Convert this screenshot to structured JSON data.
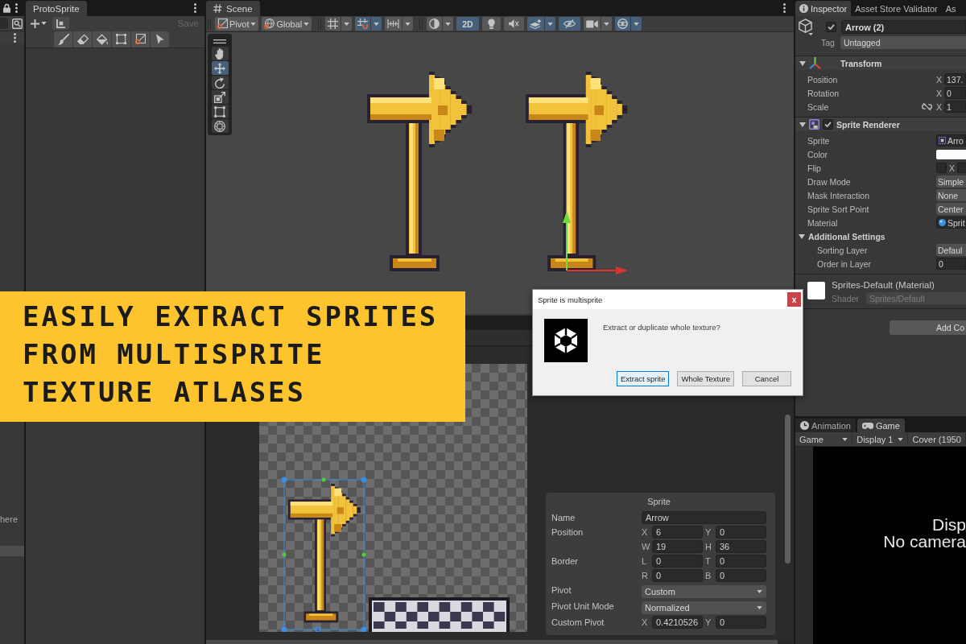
{
  "hierarchy": {
    "hint": "here",
    "rows": [
      {
        "selected": true
      }
    ]
  },
  "protosprite": {
    "tab": "ProtoSprite",
    "save": {
      "label": "Save",
      "disabled": true
    },
    "tools": [
      {
        "kind": "brush"
      },
      {
        "kind": "eraser"
      },
      {
        "kind": "fill"
      },
      {
        "kind": "select"
      },
      {
        "kind": "resize"
      },
      {
        "kind": "pointer"
      }
    ]
  },
  "scene": {
    "tab": "Scene",
    "toolbar": [
      {
        "items": [
          {
            "kind": "pivot",
            "label": "Pivot",
            "caret": true
          },
          {
            "kind": "global",
            "label": "Global",
            "caret": true
          }
        ]
      },
      {
        "items": [
          {
            "kind": "grid",
            "on": false,
            "caret": true
          },
          {
            "kind": "snap",
            "on": true,
            "caret": true
          },
          {
            "kind": "increment",
            "on": false,
            "caret": true
          }
        ]
      },
      {
        "items": [
          {
            "kind": "shading",
            "on": false,
            "caret": true
          },
          {
            "kind": "mode",
            "label": "2D",
            "on": true
          },
          {
            "kind": "light",
            "on": false
          },
          {
            "kind": "audio",
            "on": false
          },
          {
            "kind": "effects",
            "on": true,
            "caret": true
          },
          {
            "kind": "visibility",
            "on": true
          },
          {
            "kind": "camera",
            "on": false,
            "caret": true
          },
          {
            "kind": "gizmos",
            "on": true,
            "caret": true
          }
        ]
      }
    ],
    "tools": [
      {
        "kind": "hand",
        "selected": false
      },
      {
        "kind": "move",
        "selected": true
      },
      {
        "kind": "rotate",
        "selected": false
      },
      {
        "kind": "scale",
        "selected": false
      },
      {
        "kind": "rect",
        "selected": false
      },
      {
        "kind": "transform",
        "selected": false
      }
    ]
  },
  "sprite_editor": {
    "panel": {
      "title": "Sprite",
      "rows": [
        {
          "kind": "text",
          "label": "Name",
          "value": "Arrow"
        },
        {
          "kind": "pair",
          "label": "Position",
          "fields": [
            {
              "axis": "X",
              "value": "6"
            },
            {
              "axis": "Y",
              "value": "0"
            }
          ]
        },
        {
          "kind": "pair",
          "fields": [
            {
              "axis": "W",
              "value": "19"
            },
            {
              "axis": "H",
              "value": "36"
            }
          ]
        },
        {
          "kind": "pair",
          "label": "Border",
          "fields": [
            {
              "axis": "L",
              "value": "0"
            },
            {
              "axis": "T",
              "value": "0"
            }
          ]
        },
        {
          "kind": "pair",
          "fields": [
            {
              "axis": "R",
              "value": "0"
            },
            {
              "axis": "B",
              "value": "0"
            }
          ]
        },
        {
          "kind": "dropdown",
          "label": "Pivot",
          "value": "Custom"
        },
        {
          "kind": "dropdown",
          "label": "Pivot Unit Mode",
          "value": "Normalized"
        },
        {
          "kind": "pair",
          "label": "Custom Pivot",
          "fields": [
            {
              "axis": "X",
              "value": "0.4210526"
            },
            {
              "axis": "Y",
              "value": "0"
            }
          ]
        }
      ]
    }
  },
  "inspector": {
    "tabs": [
      {
        "kind": "info",
        "label": "Inspector",
        "selected": true
      },
      {
        "label": "Asset Store Validator",
        "selected": false
      },
      {
        "label": "As",
        "selected": false
      }
    ],
    "object": {
      "active": true,
      "name": "Arrow (2)",
      "tag_label": "Tag",
      "tag": "Untagged"
    },
    "components": [
      {
        "kind": "transform",
        "title": "Transform",
        "expanded": true,
        "rows": [
          {
            "kind": "vector",
            "label": "Position",
            "axis": "X",
            "value": "137."
          },
          {
            "kind": "vector",
            "label": "Rotation",
            "axis": "X",
            "value": "0"
          },
          {
            "kind": "vector",
            "label": "Scale",
            "axis": "X",
            "value": "1",
            "proportional": false
          }
        ]
      },
      {
        "kind": "sprite_renderer",
        "title": "Sprite Renderer",
        "enabled": true,
        "expanded": true,
        "rows": [
          {
            "kind": "sprite",
            "label": "Sprite",
            "value": "Arro"
          },
          {
            "kind": "color",
            "label": "Color",
            "color": "#ffffff"
          },
          {
            "kind": "flip",
            "label": "Flip",
            "axis": "X",
            "x": false,
            "y": false
          },
          {
            "kind": "dropdown",
            "label": "Draw Mode",
            "value": "Simple"
          },
          {
            "kind": "dropdown",
            "label": "Mask Interaction",
            "value": "None"
          },
          {
            "kind": "dropdown",
            "label": "Sprite Sort Point",
            "value": "Center"
          },
          {
            "kind": "material",
            "label": "Material",
            "value": "Sprit"
          }
        ],
        "subsection": {
          "title": "Additional Settings",
          "expanded": true,
          "rows": [
            {
              "kind": "dropdown",
              "label": "Sorting Layer",
              "value": "Defaul"
            },
            {
              "kind": "number",
              "label": "Order in Layer",
              "value": "0"
            }
          ]
        }
      }
    ],
    "material": {
      "name": "Sprites-Default (Material)",
      "shader_label": "Shader",
      "shader": "Sprites/Default"
    },
    "add_button": "Add Co"
  },
  "game": {
    "tabs": [
      {
        "kind": "animation",
        "label": "Animation",
        "selected": false
      },
      {
        "kind": "game",
        "label": "Game",
        "selected": true
      }
    ],
    "toolbar": [
      {
        "label": "Game",
        "caret": true
      },
      {
        "label": "Display 1",
        "caret": true
      },
      {
        "label": "Cover (1950",
        "caret": false
      }
    ],
    "message": [
      "Disp",
      "No camera"
    ]
  },
  "banner": {
    "lines": [
      "EASILY EXTRACT SPRITES",
      "FROM MULTISPRITE",
      "TEXTURE ATLASES"
    ]
  },
  "dialog": {
    "title": "Sprite is multisprite",
    "close": "x",
    "message": "Extract or duplicate whole texture?",
    "buttons": [
      {
        "label": "Extract sprite",
        "selected": true
      },
      {
        "label": "Whole Texture",
        "selected": false
      },
      {
        "label": "Cancel",
        "selected": false
      }
    ]
  }
}
